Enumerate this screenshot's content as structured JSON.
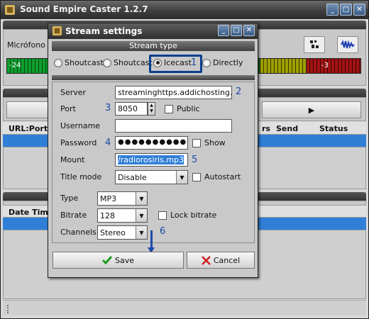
{
  "app": {
    "title": "Sound Empire Caster 1.2.7",
    "mic_label": "Micrófono (",
    "vu_left_label": "-24",
    "vu_right_label": "-3",
    "play_glyph": "▶",
    "grid1_columns": [
      "URL:Port/",
      "rs",
      "Send",
      "Status"
    ],
    "grid2_columns": [
      "Date Time"
    ]
  },
  "dialog": {
    "title": "Stream settings",
    "stream_type_header": "Stream type",
    "radio_options": [
      "Shoutcast",
      "Shoutcast",
      "Icecast",
      "Directly"
    ],
    "selected_radio": "Icecast",
    "fields": {
      "server_label": "Server",
      "server_value": "streaminghttps.addichosting.com",
      "port_label": "Port",
      "port_value": "8050",
      "public_label": "Public",
      "username_label": "Username",
      "username_value": "",
      "password_label": "Password",
      "password_value": "●●●●●●●●●●●",
      "show_label": "Show",
      "mount_label": "Mount",
      "mount_value": "/radiorosiris.mp3",
      "title_mode_label": "Title mode",
      "title_mode_value": "Disable",
      "autostart_label": "Autostart",
      "type_label": "Type",
      "type_value": "MP3",
      "bitrate_label": "Bitrate",
      "bitrate_value": "128",
      "lock_bitrate_label": "Lock bitrate",
      "channels_label": "Channels",
      "channels_value": "Stereo"
    },
    "buttons": {
      "save": "Save",
      "cancel": "Cancel"
    },
    "annotations": [
      "1",
      "2",
      "3",
      "4",
      "5",
      "6"
    ]
  },
  "colors": {
    "selection_blue": "#2f7fd7",
    "annotation_blue": "#1b4aa8",
    "save_check": "#1e9e1e",
    "cancel_x": "#d42020"
  }
}
